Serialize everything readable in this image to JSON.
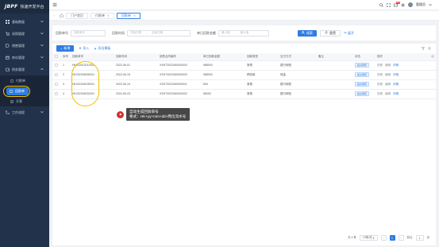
{
  "app": {
    "logo_mark": "JBPF",
    "logo_text": "快速开发平台",
    "user_name": "管理员",
    "notification_count": "99"
  },
  "sidebar": {
    "items": [
      {
        "label": "基础数据",
        "icon": "grid-icon"
      },
      {
        "label": "采购管理",
        "icon": "cart-icon"
      },
      {
        "label": "销售管理",
        "icon": "tag-icon"
      },
      {
        "label": "库存管理",
        "icon": "box-icon"
      },
      {
        "label": "财务管理",
        "icon": "wallet-icon"
      }
    ],
    "sub_items": [
      {
        "label": "付款单"
      },
      {
        "label": "回款单"
      },
      {
        "label": "开票"
      }
    ],
    "last_item": {
      "label": "工作流程",
      "icon": "flow-icon"
    }
  },
  "tabs": [
    {
      "label": "门户首页"
    },
    {
      "label": "付款单"
    },
    {
      "label": "回款单"
    }
  ],
  "filter": {
    "code_label": "回款单号",
    "code_placeholder": "回款单号",
    "date_label": "回款时间",
    "date_start": "开始日期",
    "date_sep": "-",
    "date_end": "结束日期",
    "date2_label": "单日回款金额",
    "date2_start": "最小值",
    "date2_end": "最大值",
    "search_label": "搜索",
    "reset_label": "重置",
    "collapse_label": "展开"
  },
  "toolbar": {
    "add_label": "新增",
    "import_label": "导入",
    "export_label": "导出模板"
  },
  "table": {
    "headers": [
      "序号",
      "回款单号",
      "回款时间",
      "销售合同编号",
      "单日回款金额",
      "回款类型",
      "支付方式",
      "备注",
      "状态",
      "操作"
    ],
    "rows": [
      {
        "no": "1",
        "code": "HK202012011401",
        "date": "2022-06-01",
        "contract": "XSHT2022060000003",
        "amount": "988000",
        "type": "常规",
        "pay": "银行转账",
        "note": "",
        "status": "提交审核"
      },
      {
        "no": "2",
        "code": "HK202206090001",
        "date": "2022-06-15",
        "contract": "XSHT2022060000003",
        "amount": "988000",
        "type": "预收款",
        "pay": "现金",
        "note": "",
        "status": "提交审核"
      },
      {
        "no": "3",
        "code": "HK202206190001",
        "date": "2022-06-19",
        "contract": "XSHT2022060000001",
        "amount": "600",
        "type": "常规",
        "pay": "银行转账",
        "note": "",
        "status": "提交审核"
      },
      {
        "no": "4",
        "code": "HK202206232301",
        "date": "2022-06-23",
        "contract": "XSHT2022060000002",
        "amount": "58000",
        "type": "常规",
        "pay": "银行转账",
        "note": "",
        "status": "提交审核"
      }
    ],
    "ops": [
      "查看",
      "编辑",
      "详情"
    ]
  },
  "tooltip": {
    "line1": "自动生成回款单号",
    "line2": "格式：HK+yy+mm+dd+两位流水号"
  },
  "pager": {
    "total": "共 4 条",
    "page_size": "10条/页",
    "current": "1",
    "goto_label": "前往",
    "goto_value": "1",
    "page_unit": "页"
  },
  "colors": {
    "primary": "#2e7de1",
    "sidebar_bg": "#22324a",
    "highlight": "#f2c300",
    "play_red": "#d0312d"
  }
}
